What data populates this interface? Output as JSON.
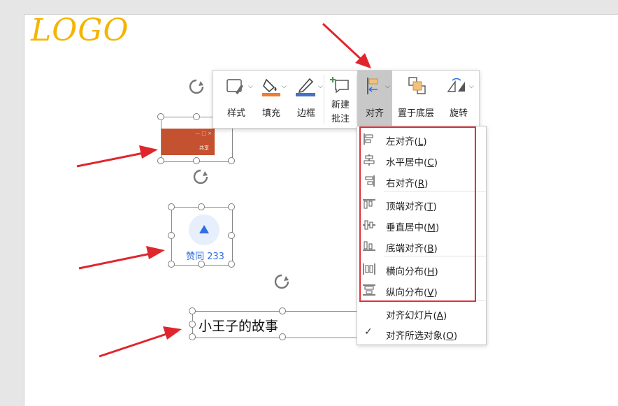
{
  "slide": {
    "logo": "LOGO",
    "like_widget_label": "赞同 233",
    "text_box": "小王子的故事",
    "thumbnail": {
      "controls": "—  □  ×",
      "share": "共享"
    }
  },
  "toolbar": {
    "style": "样式",
    "fill": "填充",
    "border": "边框",
    "new_comment_line1": "新建",
    "new_comment_line2": "批注",
    "align": "对齐",
    "send_to_back": "置于底层",
    "rotate": "旋转"
  },
  "align_menu": {
    "items": [
      {
        "label": "左对齐(",
        "key": "L",
        "icon": "align-left-icon"
      },
      {
        "label": "水平居中(",
        "key": "C",
        "icon": "align-center-icon"
      },
      {
        "label": "右对齐(",
        "key": "R",
        "icon": "align-right-icon"
      },
      {
        "label": "顶端对齐(",
        "key": "T",
        "icon": "align-top-icon"
      },
      {
        "label": "垂直居中(",
        "key": "M",
        "icon": "align-middle-icon"
      },
      {
        "label": "底端对齐(",
        "key": "B",
        "icon": "align-bottom-icon"
      },
      {
        "label": "横向分布(",
        "key": "H",
        "icon": "distribute-horizontal-icon"
      },
      {
        "label": "纵向分布(",
        "key": "V",
        "icon": "distribute-vertical-icon"
      },
      {
        "label": "对齐幻灯片(",
        "key": "A",
        "icon": ""
      },
      {
        "label": "对齐所选对象(",
        "key": "O",
        "icon": "",
        "checked": true
      }
    ],
    "close_paren": ")",
    "checkmark": "✓"
  },
  "colors": {
    "logo": "#f4b400",
    "annotation_arrow": "#e0262d",
    "highlight_box": "#e0303a",
    "like_blue": "#2f6fe0",
    "fill_swatch": "#ed7d31",
    "border_swatch": "#4472c4"
  }
}
